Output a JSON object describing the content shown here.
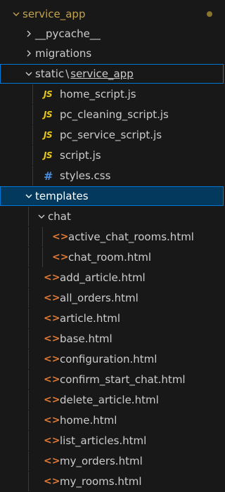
{
  "explorer": {
    "root": {
      "label": "service_app",
      "status_color": "#c2a34f"
    },
    "pycache": {
      "label": "__pycache__"
    },
    "migrations": {
      "label": "migrations"
    },
    "static_breadcrumb": {
      "part1": "static",
      "sep": "\\",
      "part2": "service_app"
    },
    "static_files": [
      {
        "label": "home_script.js",
        "icon": "js-file-icon",
        "glyph": "JS"
      },
      {
        "label": "pc_cleaning_script.js",
        "icon": "js-file-icon",
        "glyph": "JS"
      },
      {
        "label": "pc_service_script.js",
        "icon": "js-file-icon",
        "glyph": "JS"
      },
      {
        "label": "script.js",
        "icon": "js-file-icon",
        "glyph": "JS"
      },
      {
        "label": "styles.css",
        "icon": "css-file-icon",
        "glyph": "#"
      }
    ],
    "templates": {
      "label": "templates"
    },
    "chat": {
      "label": "chat"
    },
    "chat_files": [
      {
        "label": "active_chat_rooms.html",
        "glyph": "<>"
      },
      {
        "label": "chat_room.html",
        "glyph": "<>"
      }
    ],
    "template_files": [
      {
        "label": "add_article.html",
        "glyph": "<>"
      },
      {
        "label": "all_orders.html",
        "glyph": "<>"
      },
      {
        "label": "article.html",
        "glyph": "<>"
      },
      {
        "label": "base.html",
        "glyph": "<>"
      },
      {
        "label": "configuration.html",
        "glyph": "<>"
      },
      {
        "label": "confirm_start_chat.html",
        "glyph": "<>"
      },
      {
        "label": "delete_article.html",
        "glyph": "<>"
      },
      {
        "label": "home.html",
        "glyph": "<>"
      },
      {
        "label": "list_articles.html",
        "glyph": "<>"
      },
      {
        "label": "my_orders.html",
        "glyph": "<>"
      },
      {
        "label": "my_rooms.html",
        "glyph": "<>"
      }
    ]
  }
}
